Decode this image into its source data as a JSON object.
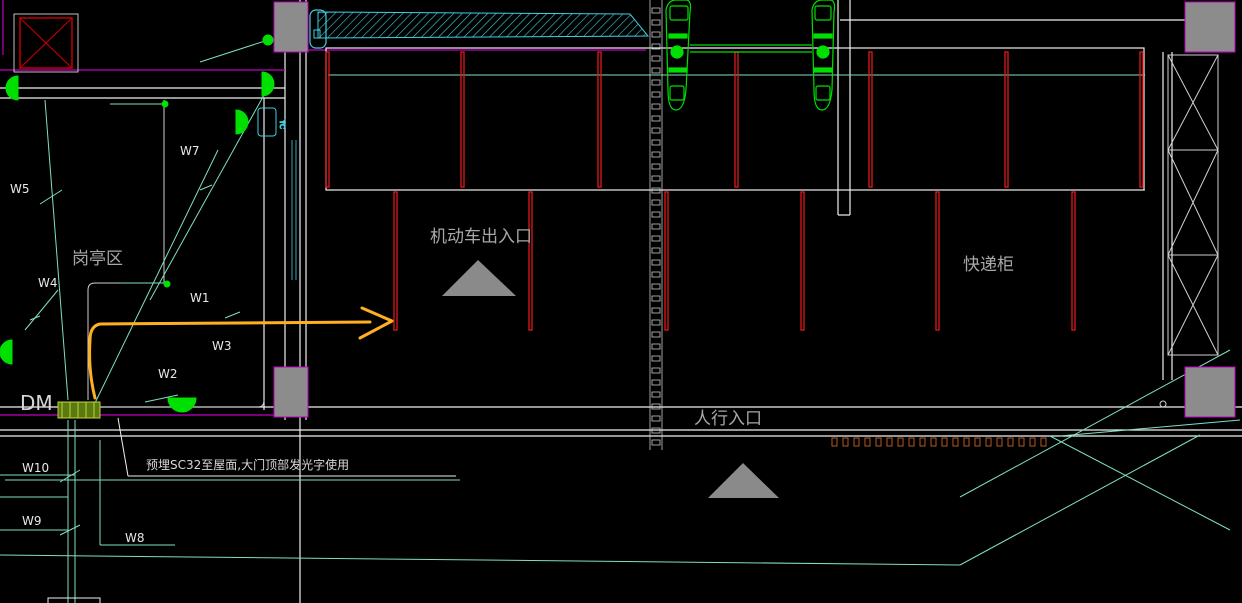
{
  "labels": {
    "guard_booth": "岗亭区",
    "vehicle_entrance": "机动车出入口",
    "pedestrian_entrance": "人行入口",
    "parcel_locker": "快递柜",
    "dm": "DM",
    "note": "预埋SC32至屋面,大门顶部发光字使用"
  },
  "wires": [
    "W1",
    "W2",
    "W3",
    "W4",
    "W5",
    "W7",
    "W8",
    "W9",
    "W10"
  ],
  "colors": {
    "background": "#000000",
    "wall": "#f2f2f2",
    "column": "#8c8c8c",
    "magenta": "#c000c0",
    "red": "#e01818",
    "green": "#00e000",
    "cyan": "#40d0e0",
    "teal_line": "#7fe0c0",
    "orange_arrow": "#ffb020",
    "brown": "#b05a20"
  },
  "icons": [
    "light-fixture-icon",
    "exit-sign-icon",
    "up-arrow-triangle-icon",
    "elevator-icon",
    "gate-barrier-icon"
  ]
}
